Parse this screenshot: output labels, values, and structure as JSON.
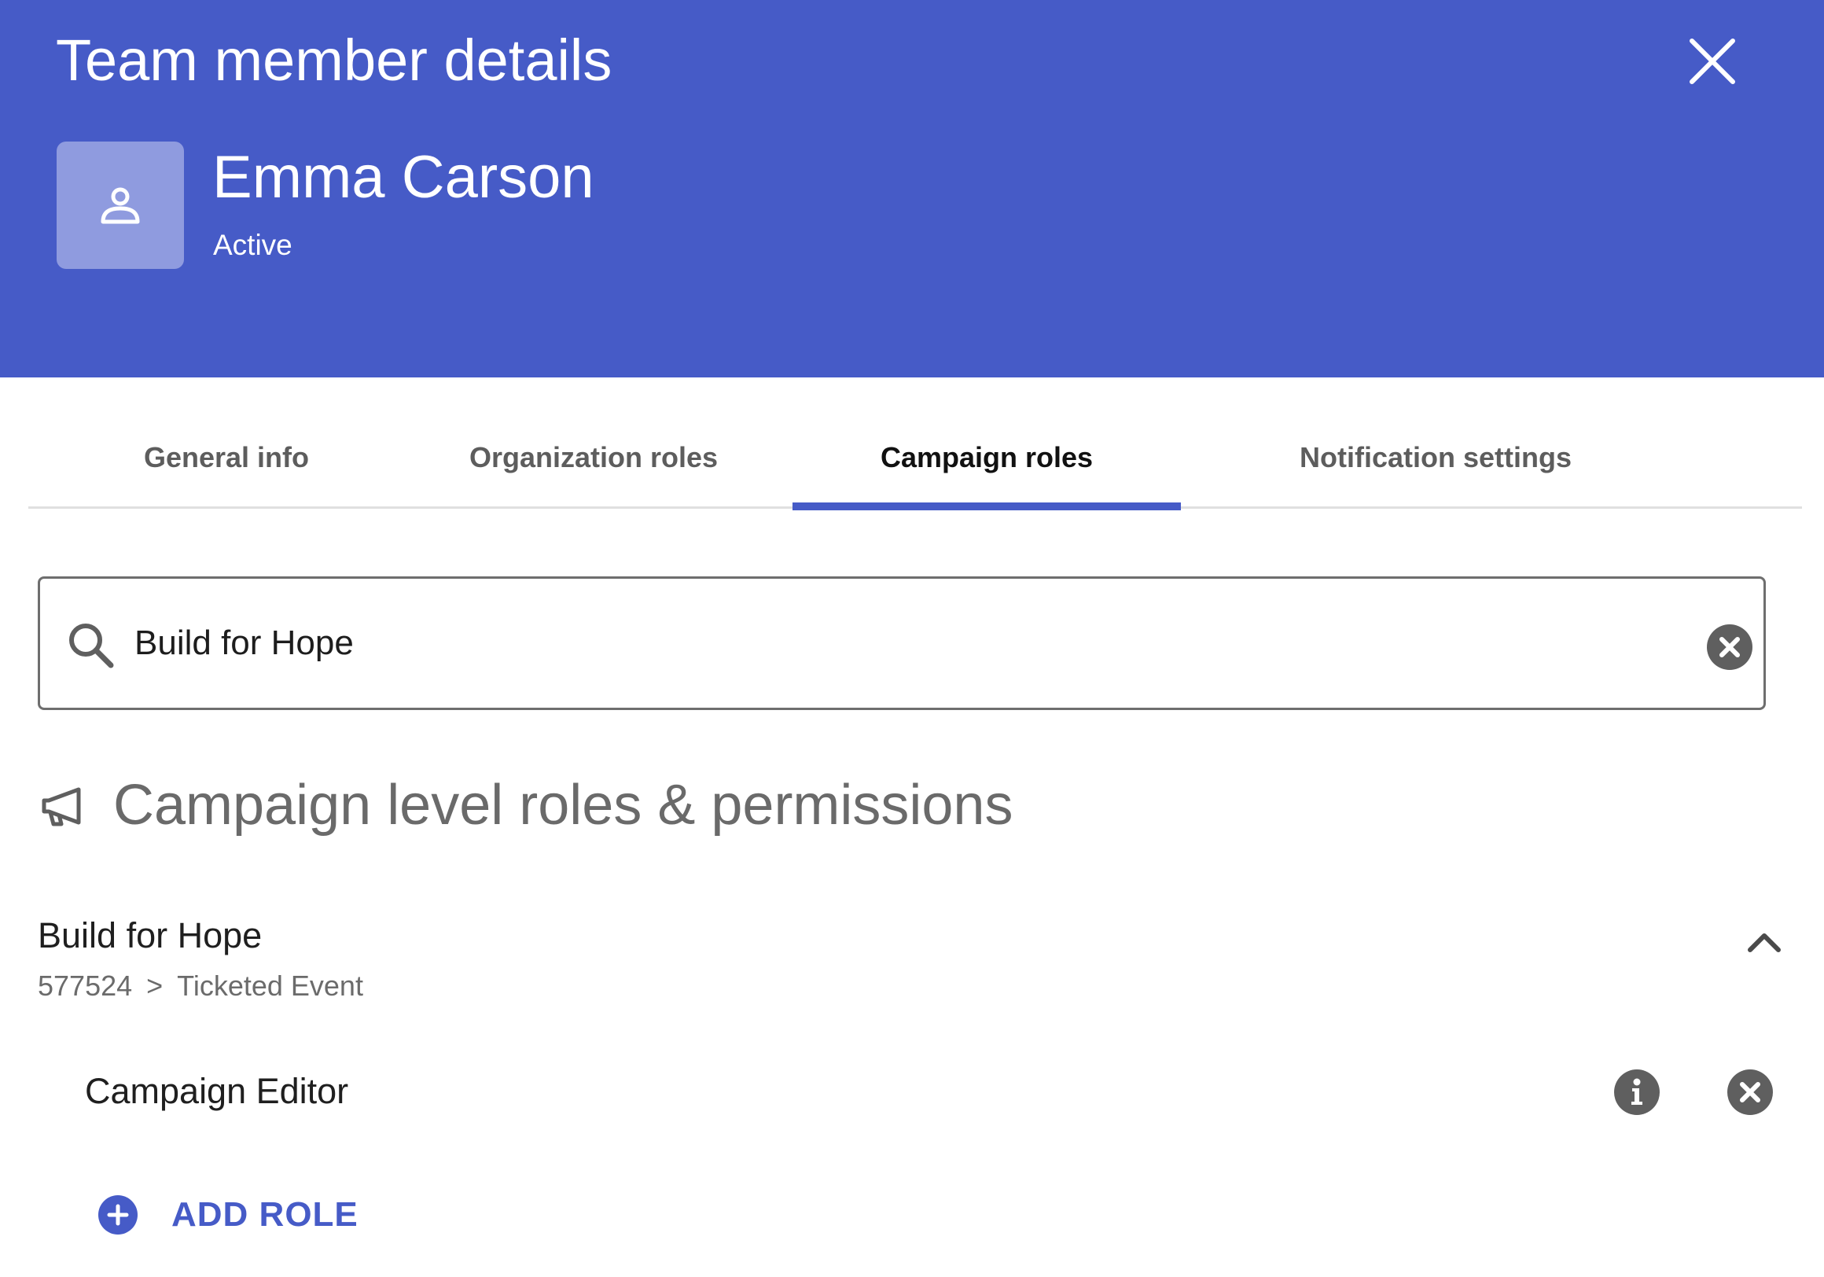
{
  "header": {
    "title": "Team member details",
    "close_icon": "close-icon",
    "background": "#465bc7"
  },
  "member": {
    "avatar_icon": "person-icon",
    "name": "Emma Carson",
    "status": "Active"
  },
  "tabs": [
    {
      "label": "General info",
      "active": false
    },
    {
      "label": "Organization roles",
      "active": false
    },
    {
      "label": "Campaign roles",
      "active": true
    },
    {
      "label": "Notification settings",
      "active": false
    }
  ],
  "search": {
    "value": "Build for Hope",
    "search_icon": "search-icon",
    "clear_icon": "clear-icon"
  },
  "section": {
    "icon": "megaphone-icon",
    "title": "Campaign level roles & permissions"
  },
  "campaign": {
    "name": "Build for Hope",
    "id": "577524",
    "separator": ">",
    "type": "Ticketed Event",
    "collapse_icon": "chevron-up-icon",
    "roles": [
      {
        "name": "Campaign Editor",
        "info_icon": "info-icon",
        "remove_icon": "remove-icon"
      }
    ],
    "add_role_label": "ADD ROLE",
    "add_role_icon": "plus-circle-icon"
  },
  "colors": {
    "accent": "#465bc7",
    "muted_text": "#6b6b6b",
    "icon_gray": "#5f5f5f"
  }
}
